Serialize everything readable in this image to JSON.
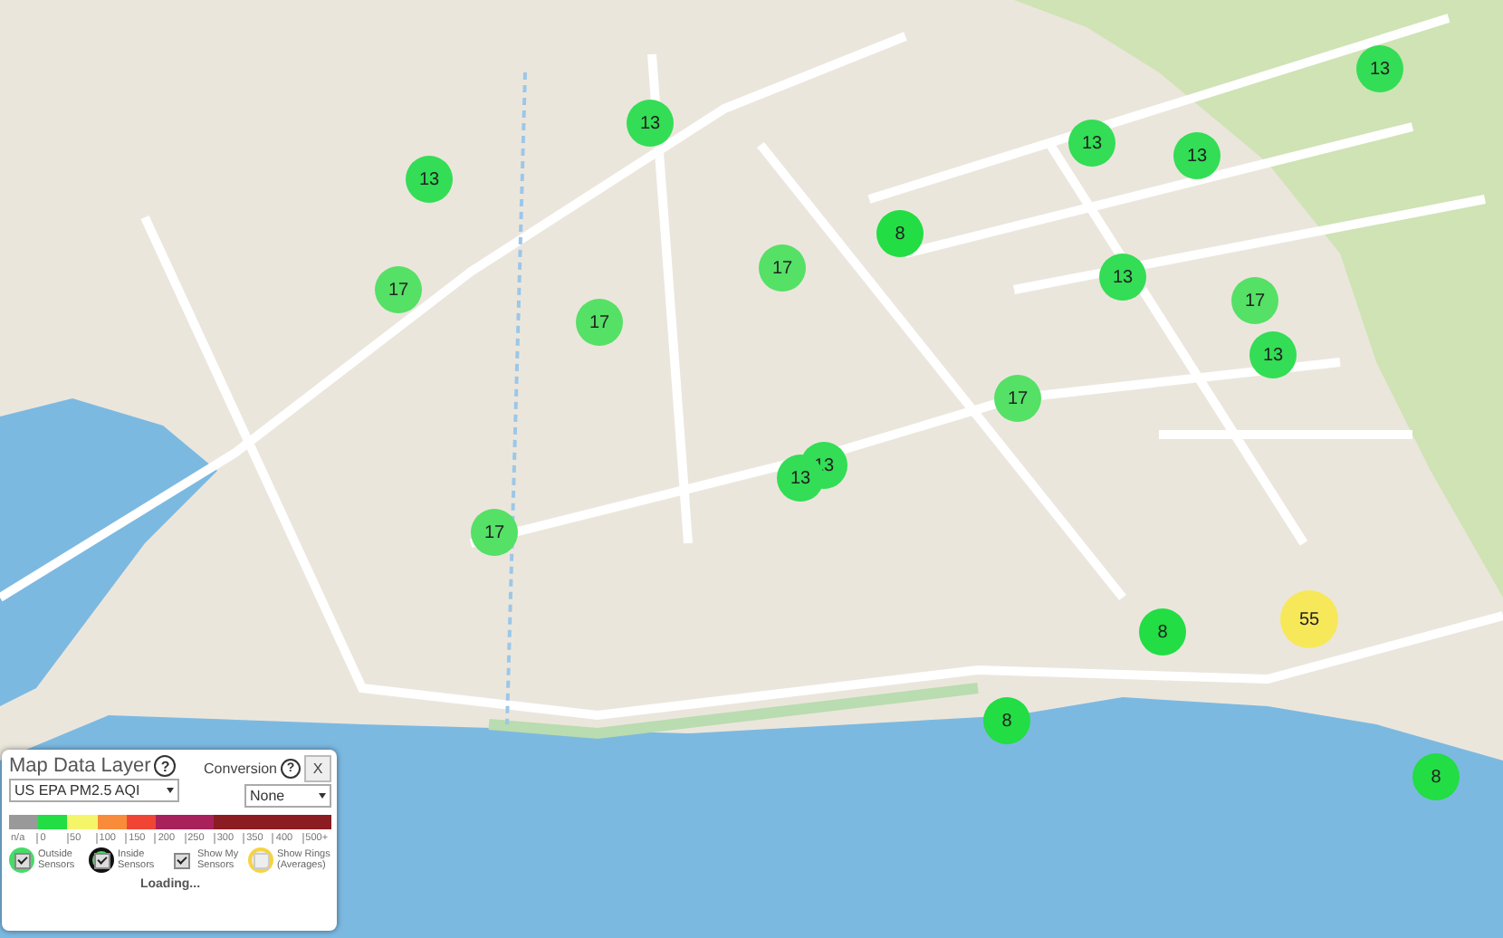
{
  "markers": [
    {
      "value": "13",
      "color": "#33dd55"
    },
    {
      "value": "13",
      "color": "#33dd55"
    },
    {
      "value": "13",
      "color": "#33dd55"
    },
    {
      "value": "13",
      "color": "#33dd55"
    },
    {
      "value": "13",
      "color": "#33dd55"
    },
    {
      "value": "8",
      "color": "#22dd44"
    },
    {
      "value": "17",
      "color": "#55e066"
    },
    {
      "value": "13",
      "color": "#33dd55"
    },
    {
      "value": "17",
      "color": "#55e066"
    },
    {
      "value": "17",
      "color": "#55e066"
    },
    {
      "value": "17",
      "color": "#55e066"
    },
    {
      "value": "13",
      "color": "#33dd55"
    },
    {
      "value": "17",
      "color": "#55e066"
    },
    {
      "value": "13",
      "color": "#33dd55"
    },
    {
      "value": "13",
      "color": "#33dd55"
    },
    {
      "value": "17",
      "color": "#55e066"
    },
    {
      "value": "55",
      "color": "#f7e859"
    },
    {
      "value": "8",
      "color": "#22dd44"
    },
    {
      "value": "8",
      "color": "#22dd44"
    },
    {
      "value": "8",
      "color": "#22dd44"
    }
  ],
  "panel": {
    "title": "Map Data Layer",
    "help": "?",
    "layer": "US EPA PM2.5 AQI",
    "conversion_label": "Conversion",
    "conversion_help": "?",
    "close": "X",
    "conversion": "None",
    "scale": [
      {
        "label": "n/a",
        "color": "#999999"
      },
      {
        "label": "0",
        "color": "#22dd44"
      },
      {
        "label": "50",
        "color": "#f5f56a"
      },
      {
        "label": "100",
        "color": "#f88c3a"
      },
      {
        "label": "150",
        "color": "#f04535"
      },
      {
        "label": "200",
        "color": "#a8215a"
      },
      {
        "label": "250",
        "color": "#a8215a"
      },
      {
        "label": "300",
        "color": "#8a1c22"
      },
      {
        "label": "350",
        "color": "#8a1c22"
      },
      {
        "label": "400",
        "color": "#8a1c22"
      },
      {
        "label": "500+",
        "color": "#8a1c22"
      }
    ],
    "options": [
      {
        "kind": "outside",
        "label": "Outside Sensors",
        "checked": true
      },
      {
        "kind": "inside",
        "label": "Inside Sensors",
        "checked": true
      },
      {
        "kind": "plain",
        "label": "Show My Sensors",
        "checked": true
      },
      {
        "kind": "rings",
        "label": "Show Rings (Averages)",
        "checked": false
      }
    ],
    "status": "Loading..."
  }
}
